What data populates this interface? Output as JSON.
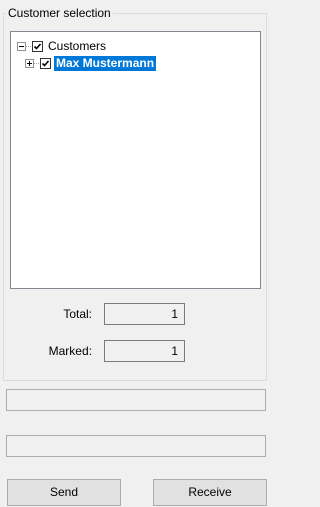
{
  "group": {
    "title": "Customer selection"
  },
  "tree": {
    "root": {
      "label": "Customers",
      "expander": "minus",
      "checked": true
    },
    "children": [
      {
        "label": "Max Mustermann",
        "expander": "plus",
        "checked": true,
        "selected": true
      }
    ]
  },
  "stats": {
    "total_label": "Total:",
    "total_value": "1",
    "marked_label": "Marked:",
    "marked_value": "1"
  },
  "status": {
    "line1": "",
    "line2": ""
  },
  "buttons": {
    "send_label": "Send",
    "receive_label": "Receive"
  },
  "colors": {
    "selection": "#0078d7",
    "background": "#f0f0f0"
  }
}
